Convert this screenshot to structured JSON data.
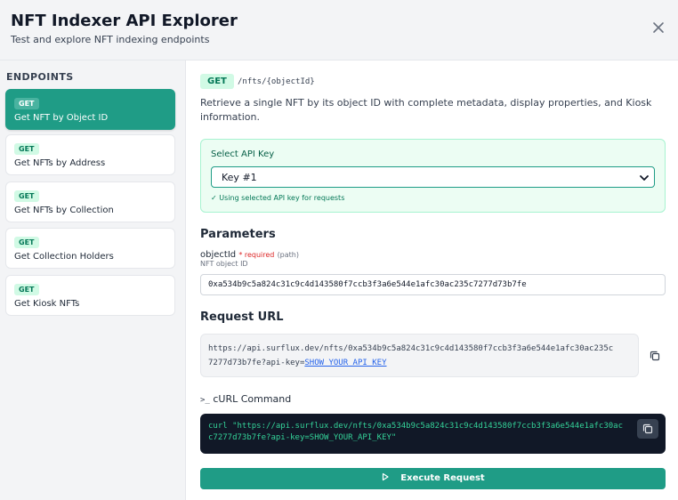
{
  "header": {
    "title": "NFT Indexer API Explorer",
    "subtitle": "Test and explore NFT indexing endpoints",
    "close_icon": "close-icon"
  },
  "sidebar": {
    "heading": "ENDPOINTS",
    "items": [
      {
        "method": "GET",
        "label": "Get NFT by Object ID",
        "active": true
      },
      {
        "method": "GET",
        "label": "Get NFTs by Address",
        "active": false
      },
      {
        "method": "GET",
        "label": "Get NFTs by Collection",
        "active": false
      },
      {
        "method": "GET",
        "label": "Get Collection Holders",
        "active": false
      },
      {
        "method": "GET",
        "label": "Get Kiosk NFTs",
        "active": false
      }
    ]
  },
  "endpoint": {
    "method": "GET",
    "path": "/nfts/{objectId}",
    "description": "Retrieve a single NFT by its object ID with complete metadata, display properties, and Kiosk information."
  },
  "api_key": {
    "label": "Select API Key",
    "selected": "Key #1",
    "hint": "✓ Using selected API key for requests"
  },
  "parameters": {
    "title": "Parameters",
    "items": [
      {
        "name": "objectId",
        "required": "* required",
        "location": "(path)",
        "description": "NFT object ID",
        "value": "0xa534b9c5a824c31c9c4d143580f7ccb3f3a6e544e1afc30ac235c7277d73b7fe"
      }
    ]
  },
  "request_url": {
    "title": "Request URL",
    "line1": "https://api.surflux.dev/nfts/0xa534b9c5a824c31c9c4d143580f7ccb3f3a6e544e1afc30ac235c",
    "line2_prefix": "7277d73b7fe?api-key=",
    "line2_key": "SHOW_YOUR_API_KEY"
  },
  "curl": {
    "prompt": ">_",
    "title": "cURL Command",
    "line1": "curl \"https://api.surflux.dev/nfts/0xa534b9c5a824c31c9c4d143580f7ccb3f3a6e544e1afc30ac",
    "line2": "c7277d73b7fe?api-key=SHOW_YOUR_API_KEY\""
  },
  "execute": {
    "label": "Execute Request"
  },
  "colors": {
    "accent": "#1f9c86",
    "badge_bg": "#d1fae5",
    "badge_text": "#047857",
    "code_bg": "#111827",
    "code_text": "#34d399",
    "required": "#dc2626"
  }
}
